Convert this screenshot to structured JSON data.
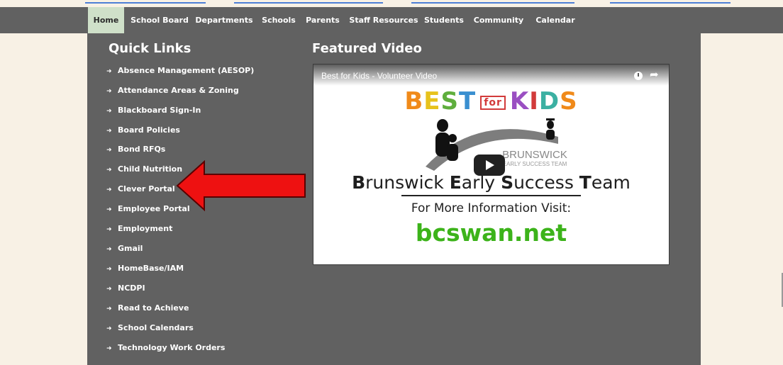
{
  "nav": {
    "items": [
      {
        "label": "Home",
        "active": true
      },
      {
        "label": "School Board"
      },
      {
        "label": "Departments"
      },
      {
        "label": "Schools"
      },
      {
        "label": "Parents"
      },
      {
        "label": "Staff Resources"
      },
      {
        "label": "Students"
      },
      {
        "label": "Community"
      },
      {
        "label": "Calendar"
      }
    ]
  },
  "quick_links": {
    "title": "Quick Links",
    "items": [
      "Absence Management (AESOP)",
      "Attendance Areas & Zoning",
      "Blackboard Sign-In",
      "Board Policies",
      "Bond RFQs",
      "Child Nutrition",
      "Clever Portal",
      "Employee Portal",
      "Employment",
      "Gmail",
      "HomeBase/IAM",
      "NCDPI",
      "Read to Achieve",
      "School Calendars",
      "Technology Work Orders"
    ],
    "highlighted_item": "Clever Portal",
    "annotation_color": "#ee1111"
  },
  "featured_video": {
    "title": "Featured Video",
    "video_title": "Best for Kids - Volunteer Video",
    "logo_letters": [
      "B",
      "E",
      "S",
      "T",
      "for",
      "K",
      "I",
      "D",
      "S"
    ],
    "logo_org": "BRUNSWICK",
    "logo_team": "EARLY SUCCESS TEAM",
    "team_name": [
      "B",
      "runswick ",
      "E",
      "arly ",
      "S",
      "uccess ",
      "T",
      "eam"
    ],
    "info_text": "For More Information Visit:",
    "site": "bcswan.net",
    "icons": [
      "clock-icon",
      "share-icon",
      "play-icon"
    ]
  },
  "colors": {
    "page_bg": "#f8f1e5",
    "nav_bg": "#616161",
    "nav_active_bg": "#cfe0c9",
    "panel_bg": "#616161",
    "site_green": "#3cb31a"
  }
}
